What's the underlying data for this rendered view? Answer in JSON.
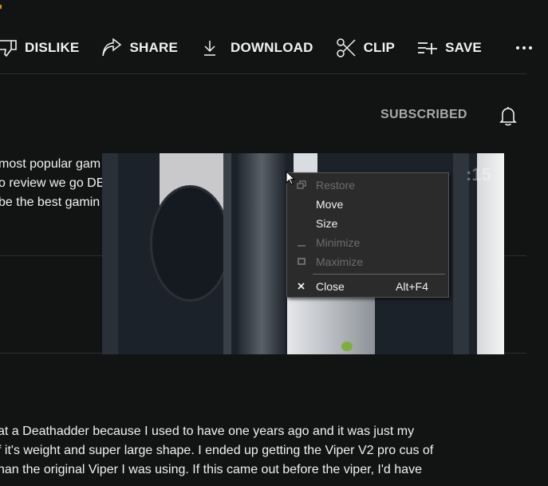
{
  "actions": [
    {
      "icon": "thumbs-down-icon",
      "label": "DISLIKE"
    },
    {
      "icon": "share-icon",
      "label": "SHARE"
    },
    {
      "icon": "download-icon",
      "label": "DOWNLOAD"
    },
    {
      "icon": "scissors-icon",
      "label": "CLIP"
    },
    {
      "icon": "playlist-add-icon",
      "label": "SAVE"
    }
  ],
  "more_icon": "more-horizontal-icon",
  "channel": {
    "subscribed_label": "SUBSCRIBED",
    "bell_icon": "bell-icon"
  },
  "description": [
    "most popular gam",
    "o review we go DE",
    "be the best gamin"
  ],
  "thumbnail": {
    "timestamp": ":15"
  },
  "context_menu": {
    "items": [
      {
        "icon": "restore-icon",
        "label": "Restore",
        "disabled": true
      },
      {
        "icon": "",
        "label": "Move",
        "disabled": false
      },
      {
        "icon": "",
        "label": "Size",
        "disabled": false
      },
      {
        "icon": "minimize-icon",
        "label": "Minimize",
        "disabled": true
      },
      {
        "icon": "maximize-icon",
        "label": "Maximize",
        "disabled": true
      },
      {
        "icon": "close-icon",
        "label": "Close",
        "shortcut": "Alt+F4",
        "disabled": false
      }
    ]
  },
  "comment": [
    "at a Deathadder because I used to have one years ago and it was just my",
    "f it's weight and super large shape. I ended up getting the Viper V2 pro cus of",
    "han the original Viper I was using. If this came out before the viper, I'd have"
  ]
}
